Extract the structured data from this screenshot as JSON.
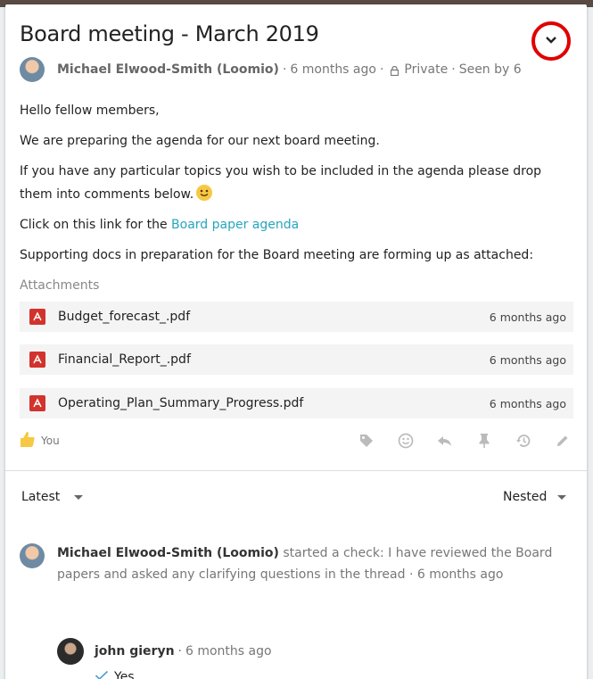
{
  "thread": {
    "title": "Board meeting - March 2019",
    "author": "Michael Elwood-Smith (Loomio)",
    "age": "6 months ago",
    "privacy": "Private",
    "seen": "Seen by 6",
    "sep": "·"
  },
  "body": {
    "p1": "Hello fellow members,",
    "p2": "We are preparing the agenda for our next board meeting.",
    "p3": "If you have any particular topics you wish to be included in the agenda please drop them into comments below.",
    "p4_prefix": "Click on this link for the ",
    "p4_link": "Board paper agenda",
    "p5": "Supporting docs in preparation for the Board meeting are forming up as attached:"
  },
  "attachments": {
    "label": "Attachments",
    "items": [
      {
        "name": "Budget_forecast_.pdf",
        "age": "6 months ago"
      },
      {
        "name": "Financial_Report_.pdf",
        "age": "6 months ago"
      },
      {
        "name": "Operating_Plan_Summary_Progress.pdf",
        "age": "6 months ago"
      }
    ]
  },
  "reactions": {
    "you": "You"
  },
  "icons": [
    "chevron-down-icon",
    "lock-icon",
    "pdf-icon",
    "thumbs-up-icon",
    "tag-icon",
    "emoji-icon",
    "reply-icon",
    "pin-icon",
    "history-icon",
    "edit-icon",
    "check-icon"
  ],
  "activity": {
    "sort_label": "Latest",
    "nest_label": "Nested"
  },
  "event": {
    "author": "Michael Elwood-Smith (Loomio)",
    "text": " started a check: I have reviewed the Board papers and asked any clarifying questions in the thread · 6 months ago"
  },
  "reply": {
    "author": "john gieryn",
    "age": "6 months ago",
    "vote": "Yes"
  },
  "colors": {
    "link": "#26a6bd",
    "highlight": "#e00000",
    "pdf": "#d2332c",
    "thumb": "#f7c843",
    "check": "#4a9fd8"
  }
}
